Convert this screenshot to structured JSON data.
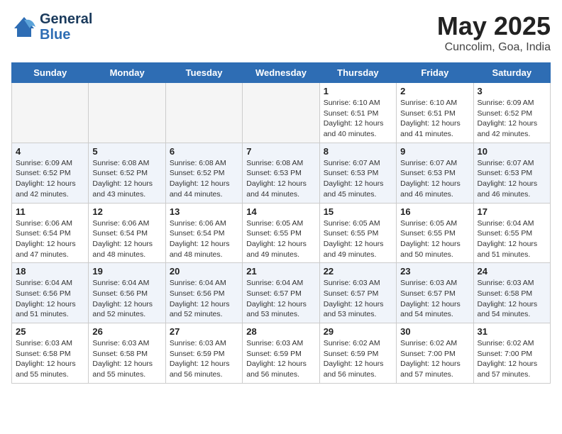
{
  "header": {
    "logo_line1": "General",
    "logo_line2": "Blue",
    "month_year": "May 2025",
    "location": "Cuncolim, Goa, India"
  },
  "days_of_week": [
    "Sunday",
    "Monday",
    "Tuesday",
    "Wednesday",
    "Thursday",
    "Friday",
    "Saturday"
  ],
  "weeks": [
    [
      {
        "day": "",
        "empty": true
      },
      {
        "day": "",
        "empty": true
      },
      {
        "day": "",
        "empty": true
      },
      {
        "day": "",
        "empty": true
      },
      {
        "day": "1",
        "sunrise": "6:10 AM",
        "sunset": "6:51 PM",
        "daylight": "12 hours and 40 minutes."
      },
      {
        "day": "2",
        "sunrise": "6:10 AM",
        "sunset": "6:51 PM",
        "daylight": "12 hours and 41 minutes."
      },
      {
        "day": "3",
        "sunrise": "6:09 AM",
        "sunset": "6:52 PM",
        "daylight": "12 hours and 42 minutes."
      }
    ],
    [
      {
        "day": "4",
        "sunrise": "6:09 AM",
        "sunset": "6:52 PM",
        "daylight": "12 hours and 42 minutes."
      },
      {
        "day": "5",
        "sunrise": "6:08 AM",
        "sunset": "6:52 PM",
        "daylight": "12 hours and 43 minutes."
      },
      {
        "day": "6",
        "sunrise": "6:08 AM",
        "sunset": "6:52 PM",
        "daylight": "12 hours and 44 minutes."
      },
      {
        "day": "7",
        "sunrise": "6:08 AM",
        "sunset": "6:53 PM",
        "daylight": "12 hours and 44 minutes."
      },
      {
        "day": "8",
        "sunrise": "6:07 AM",
        "sunset": "6:53 PM",
        "daylight": "12 hours and 45 minutes."
      },
      {
        "day": "9",
        "sunrise": "6:07 AM",
        "sunset": "6:53 PM",
        "daylight": "12 hours and 46 minutes."
      },
      {
        "day": "10",
        "sunrise": "6:07 AM",
        "sunset": "6:53 PM",
        "daylight": "12 hours and 46 minutes."
      }
    ],
    [
      {
        "day": "11",
        "sunrise": "6:06 AM",
        "sunset": "6:54 PM",
        "daylight": "12 hours and 47 minutes."
      },
      {
        "day": "12",
        "sunrise": "6:06 AM",
        "sunset": "6:54 PM",
        "daylight": "12 hours and 48 minutes."
      },
      {
        "day": "13",
        "sunrise": "6:06 AM",
        "sunset": "6:54 PM",
        "daylight": "12 hours and 48 minutes."
      },
      {
        "day": "14",
        "sunrise": "6:05 AM",
        "sunset": "6:55 PM",
        "daylight": "12 hours and 49 minutes."
      },
      {
        "day": "15",
        "sunrise": "6:05 AM",
        "sunset": "6:55 PM",
        "daylight": "12 hours and 49 minutes."
      },
      {
        "day": "16",
        "sunrise": "6:05 AM",
        "sunset": "6:55 PM",
        "daylight": "12 hours and 50 minutes."
      },
      {
        "day": "17",
        "sunrise": "6:04 AM",
        "sunset": "6:55 PM",
        "daylight": "12 hours and 51 minutes."
      }
    ],
    [
      {
        "day": "18",
        "sunrise": "6:04 AM",
        "sunset": "6:56 PM",
        "daylight": "12 hours and 51 minutes."
      },
      {
        "day": "19",
        "sunrise": "6:04 AM",
        "sunset": "6:56 PM",
        "daylight": "12 hours and 52 minutes."
      },
      {
        "day": "20",
        "sunrise": "6:04 AM",
        "sunset": "6:56 PM",
        "daylight": "12 hours and 52 minutes."
      },
      {
        "day": "21",
        "sunrise": "6:04 AM",
        "sunset": "6:57 PM",
        "daylight": "12 hours and 53 minutes."
      },
      {
        "day": "22",
        "sunrise": "6:03 AM",
        "sunset": "6:57 PM",
        "daylight": "12 hours and 53 minutes."
      },
      {
        "day": "23",
        "sunrise": "6:03 AM",
        "sunset": "6:57 PM",
        "daylight": "12 hours and 54 minutes."
      },
      {
        "day": "24",
        "sunrise": "6:03 AM",
        "sunset": "6:58 PM",
        "daylight": "12 hours and 54 minutes."
      }
    ],
    [
      {
        "day": "25",
        "sunrise": "6:03 AM",
        "sunset": "6:58 PM",
        "daylight": "12 hours and 55 minutes."
      },
      {
        "day": "26",
        "sunrise": "6:03 AM",
        "sunset": "6:58 PM",
        "daylight": "12 hours and 55 minutes."
      },
      {
        "day": "27",
        "sunrise": "6:03 AM",
        "sunset": "6:59 PM",
        "daylight": "12 hours and 56 minutes."
      },
      {
        "day": "28",
        "sunrise": "6:03 AM",
        "sunset": "6:59 PM",
        "daylight": "12 hours and 56 minutes."
      },
      {
        "day": "29",
        "sunrise": "6:02 AM",
        "sunset": "6:59 PM",
        "daylight": "12 hours and 56 minutes."
      },
      {
        "day": "30",
        "sunrise": "6:02 AM",
        "sunset": "7:00 PM",
        "daylight": "12 hours and 57 minutes."
      },
      {
        "day": "31",
        "sunrise": "6:02 AM",
        "sunset": "7:00 PM",
        "daylight": "12 hours and 57 minutes."
      }
    ]
  ]
}
